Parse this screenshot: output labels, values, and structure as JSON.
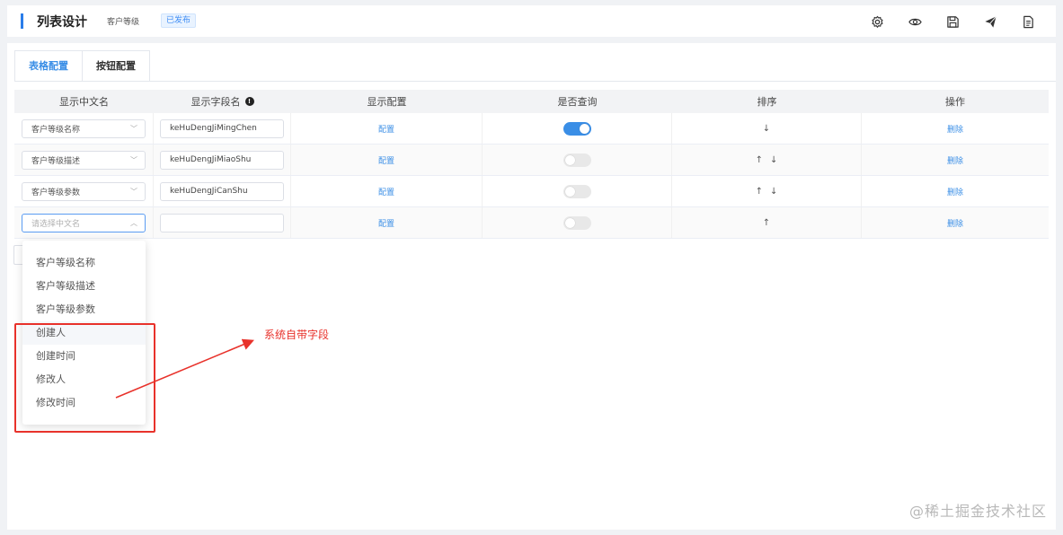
{
  "header": {
    "title": "列表设计",
    "subtitle": "客户等级",
    "status_badge": "已发布",
    "tools": [
      "settings-icon",
      "eye-icon",
      "save-icon",
      "send-icon",
      "document-icon"
    ]
  },
  "tabs": [
    {
      "label": "表格配置",
      "active": true
    },
    {
      "label": "按钮配置",
      "active": false
    }
  ],
  "table": {
    "columns": [
      "显示中文名",
      "显示字段名",
      "显示配置",
      "是否查询",
      "排序",
      "操作"
    ],
    "rows": [
      {
        "cn_name": "客户等级名称",
        "field_name": "keHuDengJiMingChen",
        "config": "配置",
        "query": true,
        "sort_up": "",
        "sort_down": "↓",
        "action": "删除"
      },
      {
        "cn_name": "客户等级描述",
        "field_name": "keHuDengJiMiaoShu",
        "config": "配置",
        "query": false,
        "sort_up": "↑",
        "sort_down": "↓",
        "action": "删除"
      },
      {
        "cn_name": "客户等级参数",
        "field_name": "keHuDengJiCanShu",
        "config": "配置",
        "query": false,
        "sort_up": "↑",
        "sort_down": "↓",
        "action": "删除"
      },
      {
        "cn_name": "",
        "cn_placeholder": "请选择中文名",
        "field_name": "",
        "config": "配置",
        "query": false,
        "sort_up": "↑",
        "sort_down": "",
        "action": "删除"
      }
    ]
  },
  "dropdown": {
    "options": [
      "客户等级名称",
      "客户等级描述",
      "客户等级参数",
      "创建人",
      "创建时间",
      "修改人",
      "修改时间"
    ],
    "highlighted_index": 3
  },
  "annotation": {
    "text": "系统自带字段",
    "color": "#e8322b"
  },
  "watermark": "@稀土掘金技术社区",
  "colors": {
    "accent": "#3a8ee6",
    "annotation": "#e8322b"
  }
}
